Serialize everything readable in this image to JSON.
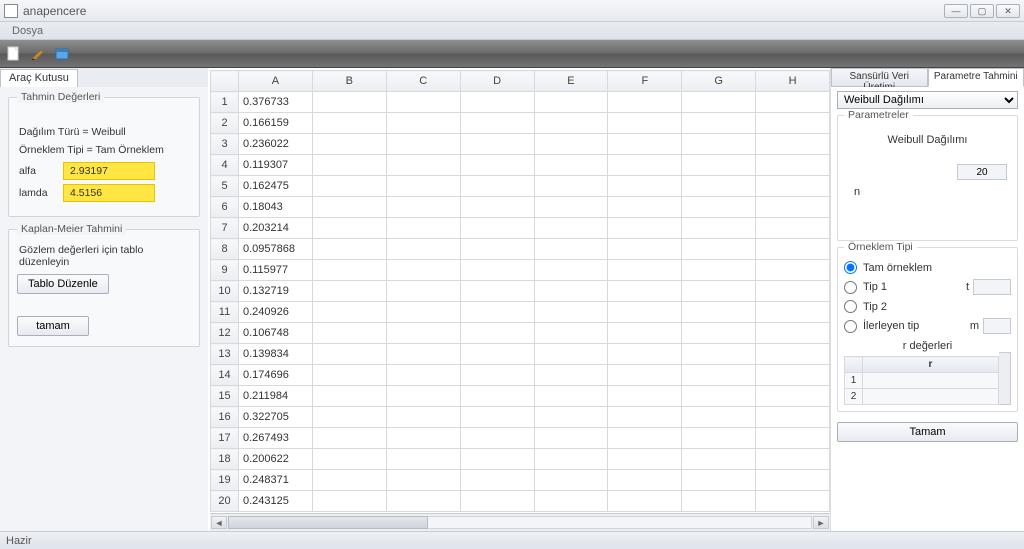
{
  "window": {
    "title": "anapencere"
  },
  "menu": {
    "file": "Dosya"
  },
  "toolbar_icons": [
    "new-icon",
    "edit-icon",
    "open-icon"
  ],
  "left_tab": "Araç Kutusu",
  "estimate_panel": {
    "title": "Tahmin Değerleri",
    "dist_label": "Dağılım Türü = Weibull",
    "sample_label": "Örneklem Tipi = Tam Örneklem",
    "alfa_label": "alfa",
    "alfa_value": "2.93197",
    "lamda_label": "lamda",
    "lamda_value": "4.5156"
  },
  "km_panel": {
    "title": "Kaplan-Meier Tahmini",
    "info": "Gözlem değerleri için tablo düzenleyin",
    "edit_btn": "Tablo Düzenle",
    "ok_btn": "tamam"
  },
  "grid": {
    "columns": [
      "A",
      "B",
      "C",
      "D",
      "E",
      "F",
      "G",
      "H"
    ],
    "rows": [
      "0.376733",
      "0.166159",
      "0.236022",
      "0.119307",
      "0.162475",
      "0.18043",
      "0.203214",
      "0.0957868",
      "0.115977",
      "0.132719",
      "0.240926",
      "0.106748",
      "0.139834",
      "0.174696",
      "0.211984",
      "0.322705",
      "0.267493",
      "0.200622",
      "0.248371",
      "0.243125"
    ]
  },
  "right_tabs": {
    "tab1": "Sansürlü Veri Üretimi",
    "tab2": "Parametre Tahmini"
  },
  "dist_combo": "Weibull Dağılımı",
  "params_group": {
    "title": "Parametreler",
    "dist_name": "Weibull Dağılımı",
    "n_label": "n",
    "n_value": "20"
  },
  "sample_group": {
    "title": "Örneklem Tipi",
    "opt_full": "Tam örneklem",
    "opt_tip1": "Tip 1",
    "opt_tip2": "Tip 2",
    "opt_prog": "İlerleyen tip",
    "t_label": "t",
    "m_label": "m",
    "r_title": "r değerleri",
    "r_col": "r"
  },
  "tamam_btn": "Tamam",
  "status": "Hazir"
}
